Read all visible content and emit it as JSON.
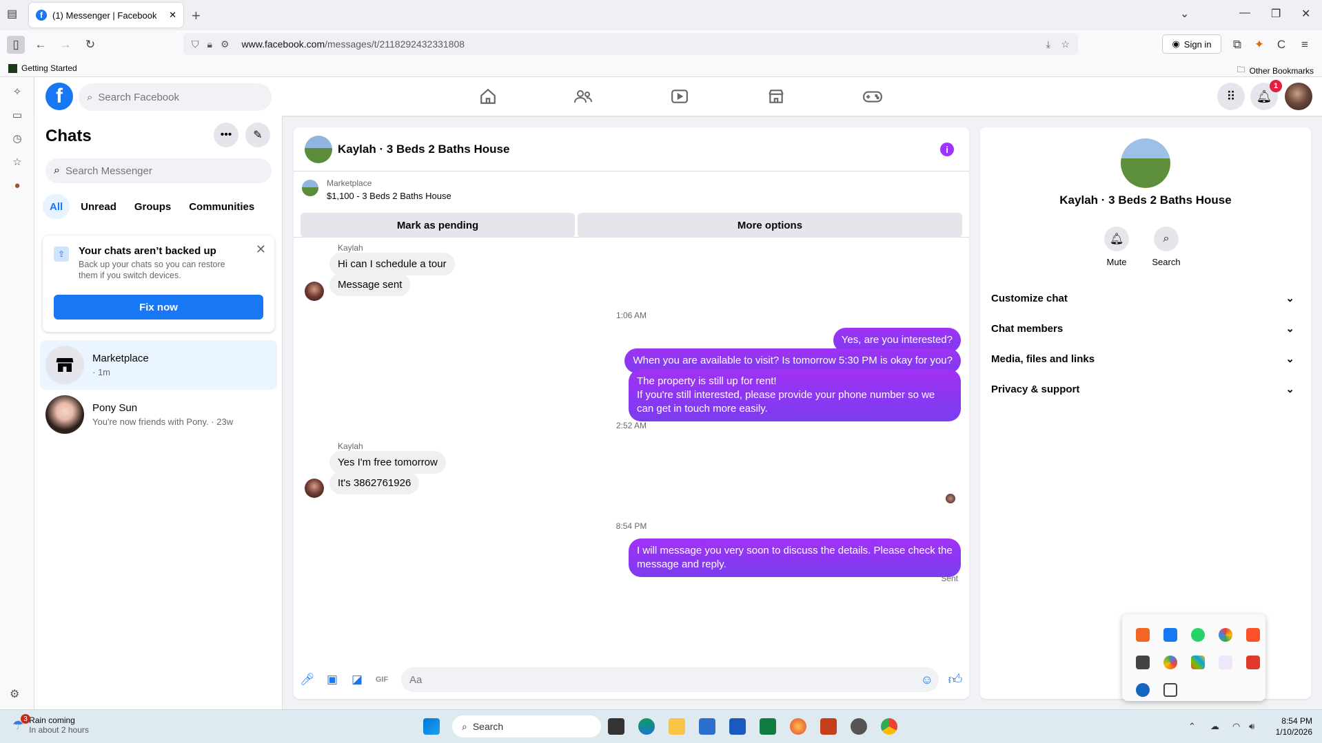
{
  "browser": {
    "tab_title": "(1) Messenger | Facebook",
    "url_domain": "www.facebook.com",
    "url_path": "/messages/t/2118292432331808",
    "sign_in": "Sign in",
    "bookmark_left": "Getting Started",
    "bookmark_right": "Other Bookmarks"
  },
  "fb": {
    "search_placeholder": "Search Facebook",
    "notification_count": "1"
  },
  "chats": {
    "title": "Chats",
    "search_placeholder": "Search Messenger",
    "filters": [
      "All",
      "Unread",
      "Groups",
      "Communities"
    ],
    "backup_title": "Your chats aren’t backed up",
    "backup_desc": "Back up your chats so you can restore them if you switch devices.",
    "fix_now": "Fix now",
    "items": [
      {
        "name": "Marketplace",
        "sub": "· 1m"
      },
      {
        "name": "Pony Sun",
        "sub": "You're now friends with Pony. · 23w"
      }
    ]
  },
  "conversation": {
    "header_name": "Kaylah · 3 Beds 2 Baths House",
    "marketplace_label": "Marketplace",
    "listing": "$1,100 - 3 Beds 2 Baths House",
    "mark_pending": "Mark as pending",
    "more_options": "More options",
    "sender1": "Kaylah",
    "in1": "Hi can I schedule a tour",
    "in2": "Message sent",
    "time1": "1:06 AM",
    "out1": "Yes, are you interested?",
    "out2": "When you are available to visit? Is tomorrow 5:30 PM is okay for you?",
    "out3_line1": "The property is still up for rent!",
    "out3_line2": "If you're still interested, please provide your phone number so we can get in touch more easily.",
    "time2": "2:52 AM",
    "sender2": "Kaylah",
    "in3": "Yes I'm free tomorrow",
    "in4": "It's 3862761926",
    "time3": "8:54 PM",
    "out4": "I will message you very soon to discuss the details. Please check the message and reply.",
    "sent_label": "Sent",
    "compose_placeholder": "Aa"
  },
  "info": {
    "name": "Kaylah · 3 Beds 2 Baths House",
    "mute": "Mute",
    "search": "Search",
    "sections": [
      "Customize chat",
      "Chat members",
      "Media, files and links",
      "Privacy & support"
    ]
  },
  "taskbar": {
    "weather_title": "Rain coming",
    "weather_sub": "In about 2 hours",
    "weather_badge": "3",
    "search": "Search",
    "time": "8:54 PM",
    "date": "1/10/2026"
  },
  "colors": {
    "fb_blue": "#1877f2",
    "outgoing_bubble": "#7b3cf0",
    "info_purple": "#a033ff"
  }
}
